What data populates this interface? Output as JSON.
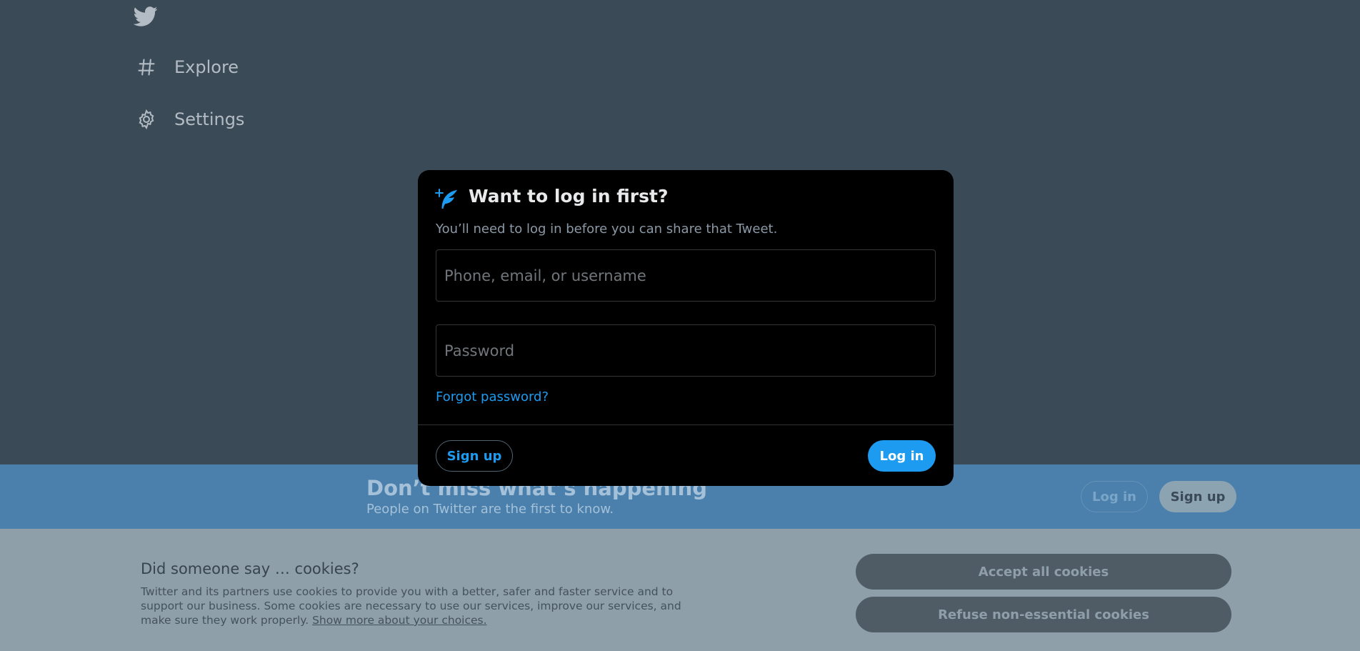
{
  "nav": {
    "logo_icon": "twitter-bird-icon",
    "items": [
      {
        "label": "Explore",
        "icon": "hashtag-icon"
      },
      {
        "label": "Settings",
        "icon": "gear-icon"
      }
    ]
  },
  "banner": {
    "title": "Don’t miss what’s happening",
    "subtitle": "People on Twitter are the first to know.",
    "login_label": "Log in",
    "signup_label": "Sign up"
  },
  "cookies": {
    "title": "Did someone say … cookies?",
    "body": "Twitter and its partners use cookies to provide you with a better, safer and faster service and to support our business. Some cookies are necessary to use our services, improve our services, and make sure they work properly.",
    "link": "Show more about your choices.",
    "accept_label": "Accept all cookies",
    "refuse_label": "Refuse non-essential cookies"
  },
  "modal": {
    "icon": "quill-sparkle-icon",
    "title": "Want to log in first?",
    "subtitle": "You’ll need to log in before you can share that Tweet.",
    "username_placeholder": "Phone, email, or username",
    "password_placeholder": "Password",
    "forgot_label": "Forgot password?",
    "signup_label": "Sign up",
    "login_label": "Log in"
  },
  "colors": {
    "accent": "#1d9bf0",
    "overlay_bg": "#3b4a57",
    "modal_bg": "#000000"
  }
}
